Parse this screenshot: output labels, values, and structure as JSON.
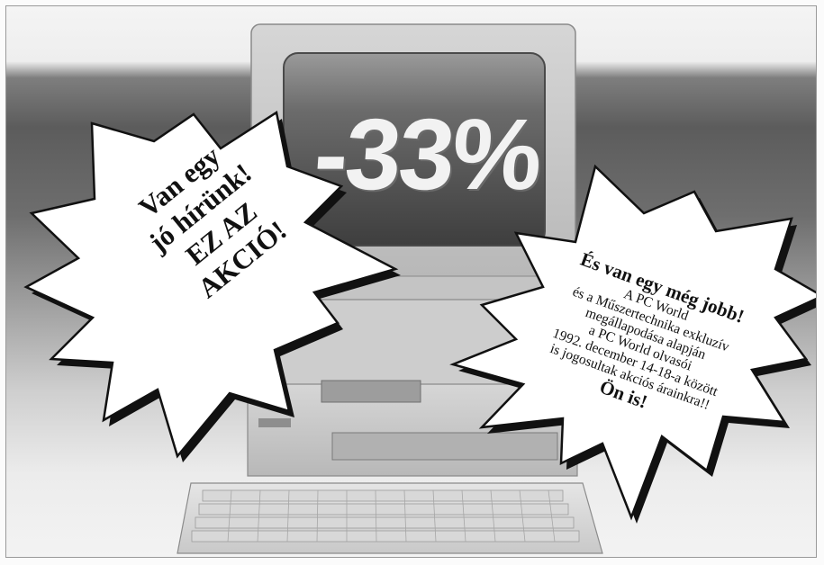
{
  "offer": {
    "discount": "-33%"
  },
  "left_burst": {
    "lines": [
      "Van egy",
      "jó hírünk!",
      "EZ AZ",
      "AKCIÓ!"
    ]
  },
  "right_burst": {
    "headline": "És van egy még jobb!",
    "body": [
      "A PC World",
      "és a Műszertechnika exkluzív",
      "megállapodása alapján",
      "a PC World olvasói",
      "1992. december 14-18-a között",
      "is jogosultak akciós árainkra!!"
    ],
    "tail": "Ön  is!"
  },
  "colors": {
    "paper": "#fbfbfb",
    "backdrop_dark": "#5c5c5c",
    "ink": "#111111",
    "burst_fill": "#ffffff"
  },
  "icons": {
    "computer": "desktop-computer-icon",
    "starburst_left": "starburst-icon",
    "starburst_right": "starburst-icon"
  }
}
